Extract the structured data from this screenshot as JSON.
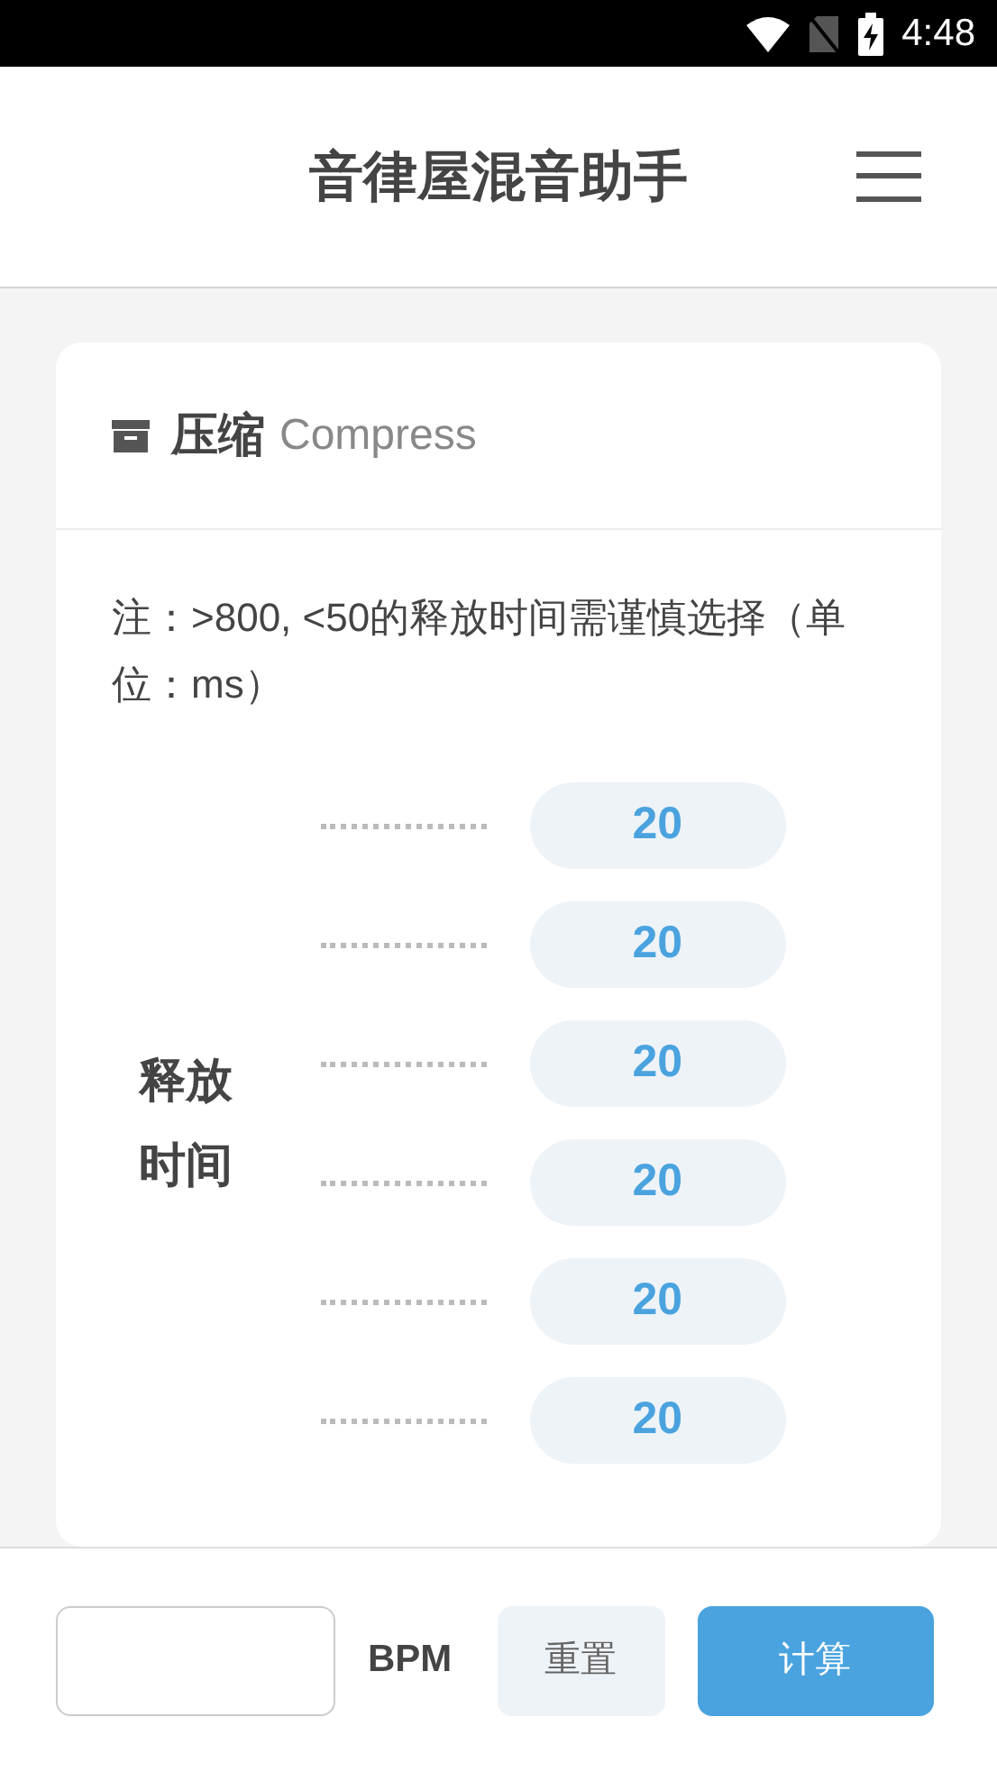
{
  "status_bar": {
    "time": "4:48"
  },
  "header": {
    "title": "音律屋混音助手"
  },
  "card": {
    "title": "压缩",
    "subtitle": "Compress",
    "note": "注：>800, <50的释放时间需谨慎选择（单位：ms）",
    "group_label": "释放时间",
    "values": [
      "20",
      "20",
      "20",
      "20",
      "20",
      "20"
    ]
  },
  "footer": {
    "bpm_unit": "BPM",
    "buttons": [
      {
        "label": "重置",
        "kind": "secondary"
      },
      {
        "label": "计算",
        "kind": "primary"
      }
    ]
  }
}
